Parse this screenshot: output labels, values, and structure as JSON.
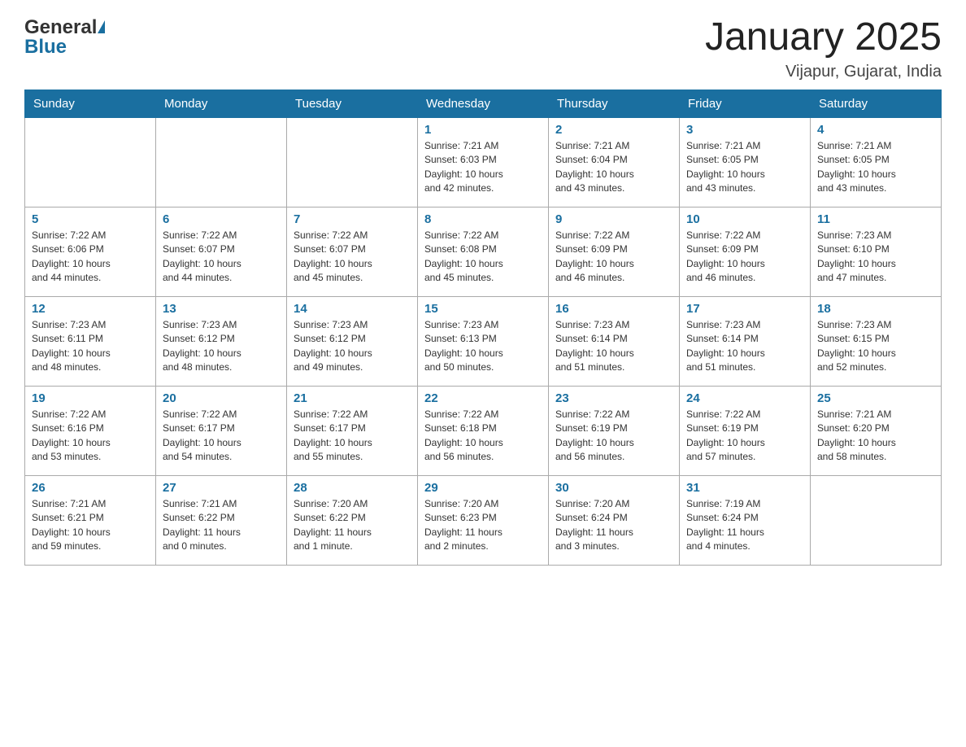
{
  "header": {
    "logo_general": "General",
    "logo_blue": "Blue",
    "month_title": "January 2025",
    "location": "Vijapur, Gujarat, India"
  },
  "days_of_week": [
    "Sunday",
    "Monday",
    "Tuesday",
    "Wednesday",
    "Thursday",
    "Friday",
    "Saturday"
  ],
  "weeks": [
    [
      {
        "day": "",
        "info": ""
      },
      {
        "day": "",
        "info": ""
      },
      {
        "day": "",
        "info": ""
      },
      {
        "day": "1",
        "info": "Sunrise: 7:21 AM\nSunset: 6:03 PM\nDaylight: 10 hours\nand 42 minutes."
      },
      {
        "day": "2",
        "info": "Sunrise: 7:21 AM\nSunset: 6:04 PM\nDaylight: 10 hours\nand 43 minutes."
      },
      {
        "day": "3",
        "info": "Sunrise: 7:21 AM\nSunset: 6:05 PM\nDaylight: 10 hours\nand 43 minutes."
      },
      {
        "day": "4",
        "info": "Sunrise: 7:21 AM\nSunset: 6:05 PM\nDaylight: 10 hours\nand 43 minutes."
      }
    ],
    [
      {
        "day": "5",
        "info": "Sunrise: 7:22 AM\nSunset: 6:06 PM\nDaylight: 10 hours\nand 44 minutes."
      },
      {
        "day": "6",
        "info": "Sunrise: 7:22 AM\nSunset: 6:07 PM\nDaylight: 10 hours\nand 44 minutes."
      },
      {
        "day": "7",
        "info": "Sunrise: 7:22 AM\nSunset: 6:07 PM\nDaylight: 10 hours\nand 45 minutes."
      },
      {
        "day": "8",
        "info": "Sunrise: 7:22 AM\nSunset: 6:08 PM\nDaylight: 10 hours\nand 45 minutes."
      },
      {
        "day": "9",
        "info": "Sunrise: 7:22 AM\nSunset: 6:09 PM\nDaylight: 10 hours\nand 46 minutes."
      },
      {
        "day": "10",
        "info": "Sunrise: 7:22 AM\nSunset: 6:09 PM\nDaylight: 10 hours\nand 46 minutes."
      },
      {
        "day": "11",
        "info": "Sunrise: 7:23 AM\nSunset: 6:10 PM\nDaylight: 10 hours\nand 47 minutes."
      }
    ],
    [
      {
        "day": "12",
        "info": "Sunrise: 7:23 AM\nSunset: 6:11 PM\nDaylight: 10 hours\nand 48 minutes."
      },
      {
        "day": "13",
        "info": "Sunrise: 7:23 AM\nSunset: 6:12 PM\nDaylight: 10 hours\nand 48 minutes."
      },
      {
        "day": "14",
        "info": "Sunrise: 7:23 AM\nSunset: 6:12 PM\nDaylight: 10 hours\nand 49 minutes."
      },
      {
        "day": "15",
        "info": "Sunrise: 7:23 AM\nSunset: 6:13 PM\nDaylight: 10 hours\nand 50 minutes."
      },
      {
        "day": "16",
        "info": "Sunrise: 7:23 AM\nSunset: 6:14 PM\nDaylight: 10 hours\nand 51 minutes."
      },
      {
        "day": "17",
        "info": "Sunrise: 7:23 AM\nSunset: 6:14 PM\nDaylight: 10 hours\nand 51 minutes."
      },
      {
        "day": "18",
        "info": "Sunrise: 7:23 AM\nSunset: 6:15 PM\nDaylight: 10 hours\nand 52 minutes."
      }
    ],
    [
      {
        "day": "19",
        "info": "Sunrise: 7:22 AM\nSunset: 6:16 PM\nDaylight: 10 hours\nand 53 minutes."
      },
      {
        "day": "20",
        "info": "Sunrise: 7:22 AM\nSunset: 6:17 PM\nDaylight: 10 hours\nand 54 minutes."
      },
      {
        "day": "21",
        "info": "Sunrise: 7:22 AM\nSunset: 6:17 PM\nDaylight: 10 hours\nand 55 minutes."
      },
      {
        "day": "22",
        "info": "Sunrise: 7:22 AM\nSunset: 6:18 PM\nDaylight: 10 hours\nand 56 minutes."
      },
      {
        "day": "23",
        "info": "Sunrise: 7:22 AM\nSunset: 6:19 PM\nDaylight: 10 hours\nand 56 minutes."
      },
      {
        "day": "24",
        "info": "Sunrise: 7:22 AM\nSunset: 6:19 PM\nDaylight: 10 hours\nand 57 minutes."
      },
      {
        "day": "25",
        "info": "Sunrise: 7:21 AM\nSunset: 6:20 PM\nDaylight: 10 hours\nand 58 minutes."
      }
    ],
    [
      {
        "day": "26",
        "info": "Sunrise: 7:21 AM\nSunset: 6:21 PM\nDaylight: 10 hours\nand 59 minutes."
      },
      {
        "day": "27",
        "info": "Sunrise: 7:21 AM\nSunset: 6:22 PM\nDaylight: 11 hours\nand 0 minutes."
      },
      {
        "day": "28",
        "info": "Sunrise: 7:20 AM\nSunset: 6:22 PM\nDaylight: 11 hours\nand 1 minute."
      },
      {
        "day": "29",
        "info": "Sunrise: 7:20 AM\nSunset: 6:23 PM\nDaylight: 11 hours\nand 2 minutes."
      },
      {
        "day": "30",
        "info": "Sunrise: 7:20 AM\nSunset: 6:24 PM\nDaylight: 11 hours\nand 3 minutes."
      },
      {
        "day": "31",
        "info": "Sunrise: 7:19 AM\nSunset: 6:24 PM\nDaylight: 11 hours\nand 4 minutes."
      },
      {
        "day": "",
        "info": ""
      }
    ]
  ]
}
